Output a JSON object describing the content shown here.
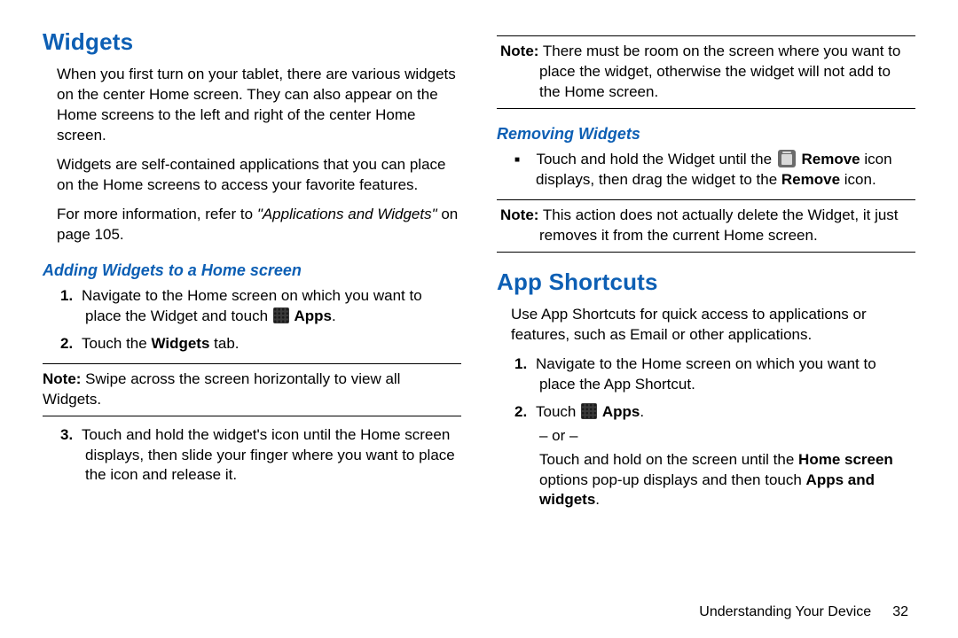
{
  "left": {
    "h1": "Widgets",
    "p1": "When you first turn on your tablet, there are various widgets on the center Home screen. They can also appear on the Home screens to the left and right of the center Home screen.",
    "p2": "Widgets are self-contained applications that you can place on the Home screens to access your favorite features.",
    "p3_a": "For more information, refer to ",
    "p3_ref": "\"Applications and Widgets\"",
    "p3_b": " on page 105.",
    "h2": "Adding Widgets to a Home screen",
    "s1_num": "1.",
    "s1_a": "Navigate to the Home screen on which you want to place the Widget and touch ",
    "s1_apps": "Apps",
    "s1_b": ".",
    "s2_num": "2.",
    "s2_a": "Touch the ",
    "s2_b": "Widgets",
    "s2_c": " tab.",
    "note_label": "Note:",
    "note1": " Swipe across the screen horizontally to view all Widgets.",
    "s3_num": "3.",
    "s3": "Touch and hold the widget's icon until the Home screen displays, then slide your finger where you want to place the icon and release it."
  },
  "right": {
    "note_label": "Note:",
    "note1": " There must be room on the screen where you want to place the widget, otherwise the widget will not add to the Home screen.",
    "h2": "Removing Widgets",
    "bullet_a": "Touch and hold the Widget until the ",
    "bullet_remove": "Remove",
    "bullet_b": " icon displays, then drag the widget to the ",
    "bullet_c": " icon.",
    "note2": " This action does not actually delete the Widget, it just removes it from the current Home screen.",
    "h1": "App Shortcuts",
    "p1": "Use App Shortcuts for quick access to applications or features, such as Email or other applications.",
    "s1_num": "1.",
    "s1": "Navigate to the Home screen on which you want to place the App Shortcut.",
    "s2_num": "2.",
    "s2_a": "Touch ",
    "s2_apps": "Apps",
    "s2_b": ".",
    "or": "– or –",
    "s2_c": "Touch and hold on the screen until the ",
    "s2_home": "Home screen",
    "s2_d": " options pop-up displays and then touch ",
    "s2_aw": "Apps and widgets",
    "s2_e": "."
  },
  "footer": {
    "section": "Understanding Your Device",
    "page": "32"
  }
}
